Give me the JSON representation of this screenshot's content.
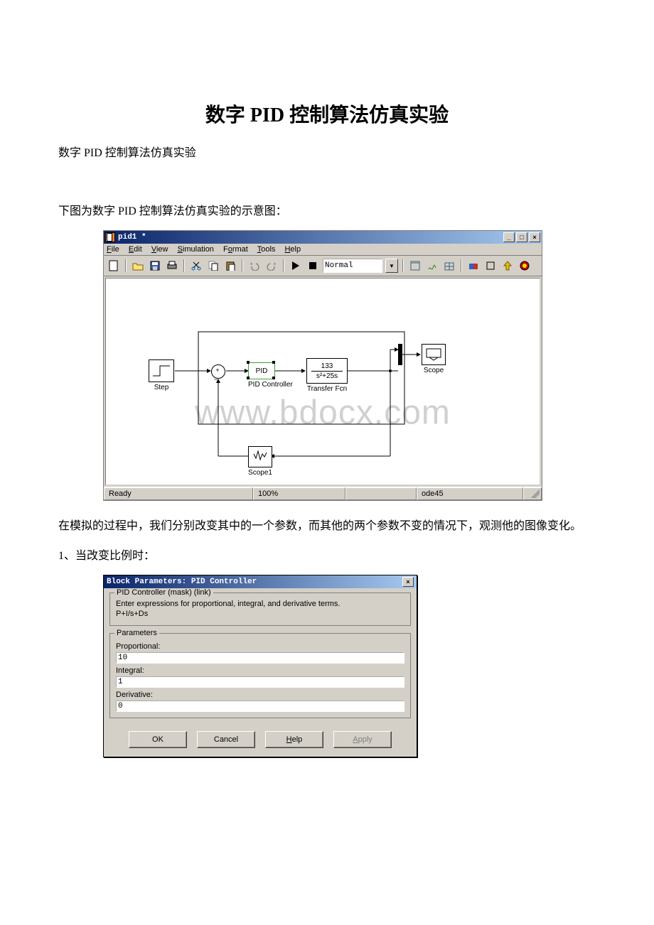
{
  "doc": {
    "title": "数字 PID 控制算法仿真实验",
    "subtitle": "数字 PID 控制算法仿真实验",
    "caption": "下图为数字 PID 控制算法仿真实验的示意图：",
    "para_after": "在模拟的过程中，我们分别改变其中的一个参数，而其他的两个参数不变的情况下，观测他的图像变化。",
    "item1": "1、当改变比例时："
  },
  "simulink": {
    "title": "pid1 *",
    "menu": {
      "file": "File",
      "edit": "Edit",
      "view": "View",
      "simulation": "Simulation",
      "format": "Format",
      "tools": "Tools",
      "help": "Help"
    },
    "toolbar": {
      "mode": "Normal"
    },
    "blocks": {
      "step": "Step",
      "pid_box": "PID",
      "pid_label": "PID Controller",
      "tf_num": "133",
      "tf_den": "s²+25s",
      "tf_label": "Transfer Fcn",
      "scope": "Scope",
      "scope1": "Scope1"
    },
    "status": {
      "ready": "Ready",
      "zoom": "100%",
      "solver": "ode45"
    },
    "watermark": "www.bdocx.com"
  },
  "dialog": {
    "title": "Block Parameters: PID Controller",
    "group1_legend": "PID Controller (mask) (link)",
    "desc1": "Enter expressions for proportional, integral, and derivative terms.",
    "desc2": "P+I/s+Ds",
    "group2_legend": "Parameters",
    "label_p": "Proportional:",
    "val_p": "10",
    "label_i": "Integral:",
    "val_i": "1",
    "label_d": "Derivative:",
    "val_d": "0",
    "btn_ok": "OK",
    "btn_cancel": "Cancel",
    "btn_help": "Help",
    "btn_apply": "Apply"
  }
}
